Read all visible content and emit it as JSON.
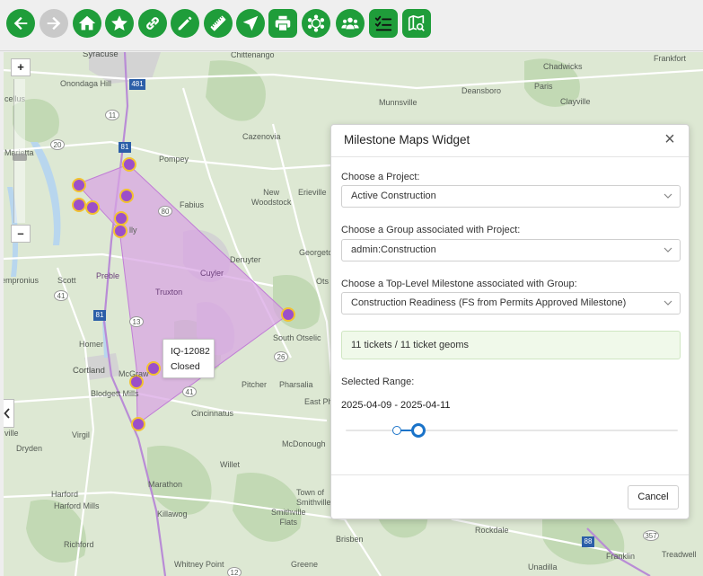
{
  "toolbar": {
    "buttons": [
      {
        "name": "back-button",
        "icon": "arrow-left-icon"
      },
      {
        "name": "forward-button",
        "icon": "arrow-right-icon",
        "disabled": true
      },
      {
        "name": "home-button",
        "icon": "home-icon"
      },
      {
        "name": "favorites-button",
        "icon": "star-icon"
      },
      {
        "name": "link-button",
        "icon": "link-icon"
      },
      {
        "name": "edit-button",
        "icon": "pencil-icon"
      },
      {
        "name": "measure-button",
        "icon": "ruler-icon"
      },
      {
        "name": "navigate-button",
        "icon": "location-arrow-icon"
      },
      {
        "name": "print-button",
        "icon": "printer-icon"
      },
      {
        "name": "network-button",
        "icon": "network-icon"
      },
      {
        "name": "users-button",
        "icon": "users-icon"
      },
      {
        "name": "checklist-button",
        "icon": "checklist-icon"
      },
      {
        "name": "map-search-button",
        "icon": "map-search-icon"
      }
    ],
    "accent": "#1f9d3a"
  },
  "map": {
    "zoom_in": "+",
    "zoom_out": "–",
    "polygon_color": "#d8a3e3",
    "marker_color": "#9b4fc9",
    "marker_stroke": "#f2c230",
    "places": {
      "syracuse": "Syracuse",
      "chittenango": "Chittenango",
      "chadwicks": "Chadwicks",
      "frankfort": "Frankfort",
      "onondaga_hill": "Onondaga Hill",
      "deansboro": "Deansboro",
      "paris": "Paris",
      "cellus": "cellus",
      "munnsville": "Munnsville",
      "clayville": "Clayville",
      "cazenovia": "Cazenovia",
      "marietta": "Marietta",
      "pompey": "Pompey",
      "new_woodstock": "New\nWoodstock",
      "erieville": "Erieville",
      "fabius": "Fabius",
      "lly": "lly",
      "deruyter": "Deruyter",
      "georgetown": "Georgetc",
      "sempronius": "empronius",
      "scott": "Scott",
      "preble": "Preble",
      "cuyler": "Cuyler",
      "truxton": "Truxton",
      "otselic": "Ots",
      "homer": "Homer",
      "south_otselic": "South Otselic",
      "cortland": "Cortland",
      "mcgraw": "McGraw",
      "blodgett_mills": "Blodgett Mills",
      "pitcher": "Pitcher",
      "pharsalia": "Pharsalia",
      "east_pharsalia": "East Ph",
      "ville": "ville",
      "cincinnatus": "Cincinnatus",
      "virgil": "Virgil",
      "dryden": "Dryden",
      "mcdonough": "McDonough",
      "willet": "Willet",
      "marathon": "Marathon",
      "harford": "Harford",
      "harford_mills": "Harford Mills",
      "town_of_smithville": "Town of\nSmithville",
      "smithville_flats": "Smithville\nFlats",
      "killawog": "Killawog",
      "rockdale": "Rockdale",
      "brisben": "Brisben",
      "richford": "Richford",
      "whitney_point": "Whitney Point",
      "greene": "Greene",
      "franklin": "Franklin",
      "treadwell": "Treadwell",
      "unadilla": "Unadilla",
      "route_20": "20",
      "route_481": "481",
      "route_11": "11",
      "route_81": "81",
      "route_80": "80",
      "route_41": "41",
      "route_13": "13",
      "route_26": "26",
      "route_12": "12",
      "route_8": "8",
      "route_88": "88",
      "route_357": "357"
    },
    "tooltip": {
      "line1": "IQ-12082",
      "line2": "Closed"
    }
  },
  "widget": {
    "title": "Milestone Maps Widget",
    "close": "×",
    "project_label": "Choose a Project:",
    "project_value": "Active Construction",
    "group_label": "Choose a Group associated with Project:",
    "group_value": "admin:Construction",
    "milestone_label": "Choose a Top-Level Milestone associated with Group:",
    "milestone_value": "Construction Readiness (FS from Permits Approved Milestone)",
    "info": "11 tickets / 11 ticket geoms",
    "range_label": "Selected Range:",
    "range_value": "2025-04-09 - 2025-04-11",
    "cancel": "Cancel",
    "slider_color": "#1a73c9"
  }
}
